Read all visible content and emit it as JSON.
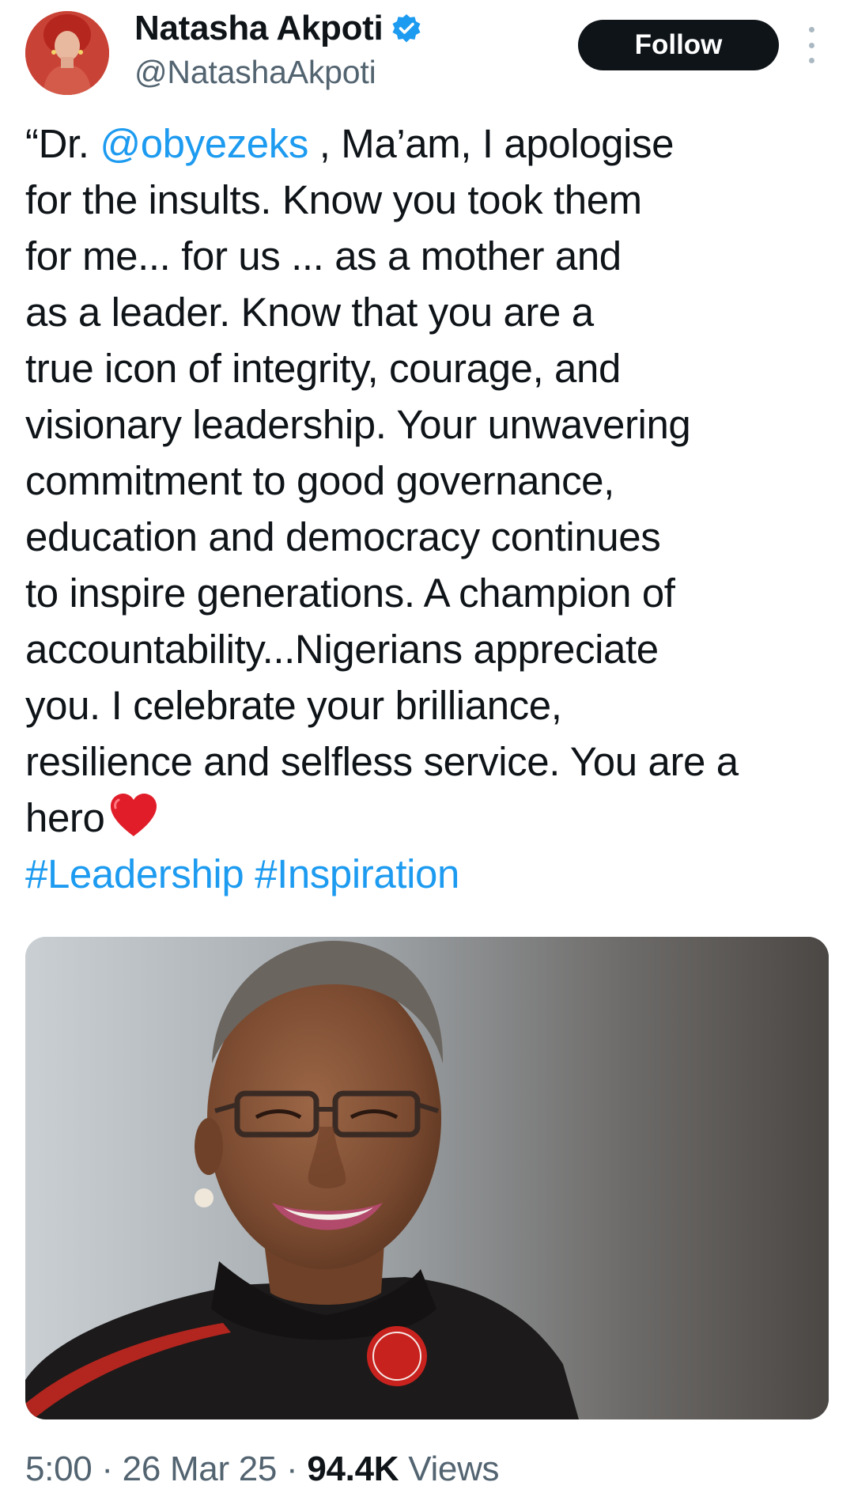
{
  "author": {
    "display_name": "Natasha Akpoti",
    "handle": "@NatashaAkpoti",
    "verified_icon": "verified-badge-icon",
    "avatar_icon": "profile-avatar"
  },
  "actions": {
    "follow_label": "Follow",
    "more_icon": "more-options-icon"
  },
  "tweet": {
    "lines": [
      {
        "pre": "“Dr. ",
        "mention": "@obyezeks",
        "post": " , Ma’am, I apologise"
      },
      {
        "text": "for the insults. Know you took them"
      },
      {
        "text": "for me... for us ... as a mother and"
      },
      {
        "text": "as a leader. Know that you are a"
      },
      {
        "text": "true icon of integrity, courage, and"
      },
      {
        "text": "visionary leadership. Your unwavering"
      },
      {
        "text": "commitment to good governance,"
      },
      {
        "text": "education and democracy continues"
      },
      {
        "text": "to inspire generations. A champion of"
      },
      {
        "text": "accountability...Nigerians appreciate"
      },
      {
        "text": "you. I celebrate your brilliance,"
      },
      {
        "text": "resilience and selfless service. You are a"
      },
      {
        "text": "hero",
        "emoji": "red-heart-icon"
      }
    ],
    "hashtags": [
      "#Leadership",
      "#Inspiration"
    ]
  },
  "media": {
    "icon": "portrait-photo"
  },
  "meta": {
    "time": "5:00",
    "separator": "·",
    "date": "26 Mar 25",
    "views_count": "94.4K",
    "views_label": "Views"
  },
  "colors": {
    "link": "#1d9bf0",
    "text": "#0f1419",
    "secondary": "#536471",
    "follow_bg": "#0f1419"
  }
}
